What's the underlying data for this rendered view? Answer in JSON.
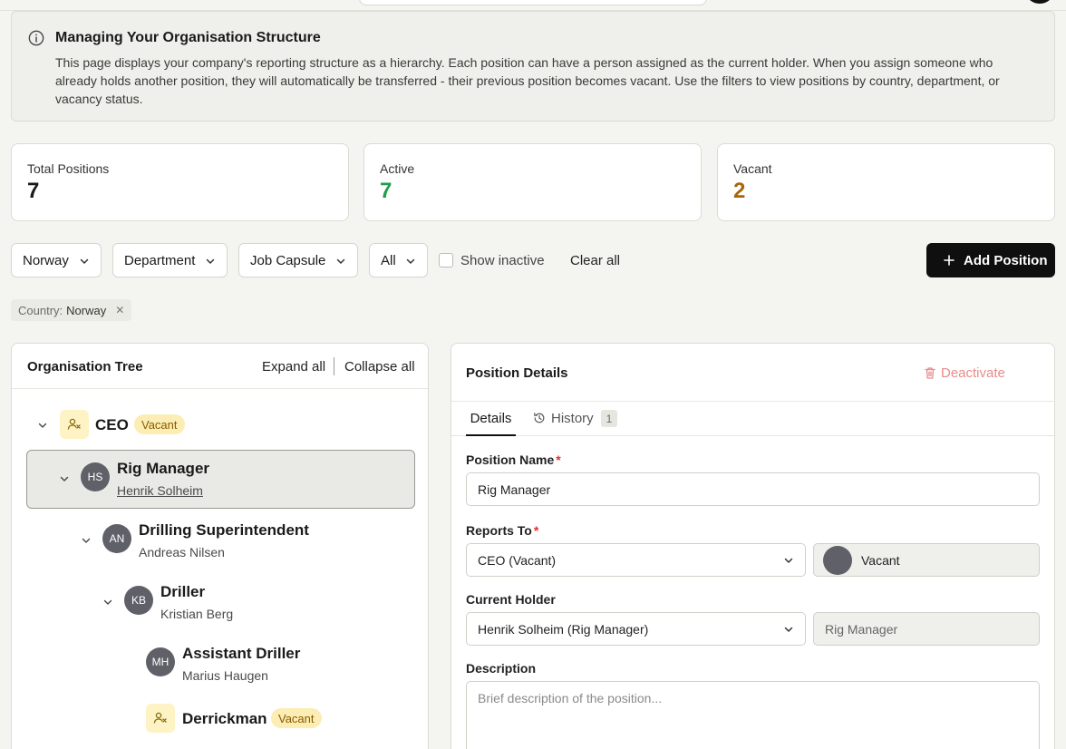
{
  "info": {
    "title": "Managing Your Organisation Structure",
    "text": "This page displays your company's reporting structure as a hierarchy. Each position can have a person assigned as the current holder. When you assign someone who already holds another position, they will automatically be transferred - their previous position becomes vacant. Use the filters to view positions by country, department, or vacancy status."
  },
  "stats": {
    "total": {
      "label": "Total Positions",
      "value": "7",
      "color": "#1a1a1a"
    },
    "active": {
      "label": "Active",
      "value": "7",
      "color": "#1f9d4c"
    },
    "vacant": {
      "label": "Vacant",
      "value": "2",
      "color": "#a8650a"
    }
  },
  "filters": {
    "country": "Norway",
    "department": "Department",
    "job_capsule": "Job Capsule",
    "status": "All",
    "show_inactive": "Show inactive",
    "clear_all": "Clear all",
    "add_position": "Add Position"
  },
  "chip": {
    "key": "Country:",
    "value": "Norway"
  },
  "tree": {
    "title": "Organisation Tree",
    "expand_all": "Expand all",
    "collapse_all": "Collapse all",
    "vacant_badge": "Vacant",
    "nodes": [
      {
        "name": "CEO",
        "holder": "",
        "initials": ""
      },
      {
        "name": "Rig Manager",
        "holder": "Henrik Solheim",
        "initials": "HS"
      },
      {
        "name": "Drilling Superintendent",
        "holder": "Andreas Nilsen",
        "initials": "AN"
      },
      {
        "name": "Driller",
        "holder": "Kristian Berg",
        "initials": "KB"
      },
      {
        "name": "Assistant Driller",
        "holder": "Marius Haugen",
        "initials": "MH"
      },
      {
        "name": "Derrickman",
        "holder": "",
        "initials": ""
      }
    ]
  },
  "details": {
    "title": "Position Details",
    "deactivate": "Deactivate",
    "tabs": {
      "details": "Details",
      "history": "History",
      "history_count": "1"
    },
    "position_name_label": "Position Name",
    "position_name_value": "Rig Manager",
    "reports_to_label": "Reports To",
    "reports_to_value": "CEO (Vacant)",
    "reports_to_holder": "Vacant",
    "current_holder_label": "Current Holder",
    "current_holder_value": "Henrik Solheim (Rig Manager)",
    "current_holder_position": "Rig Manager",
    "description_label": "Description",
    "description_placeholder": "Brief description of the position...",
    "required_mark": "*"
  }
}
